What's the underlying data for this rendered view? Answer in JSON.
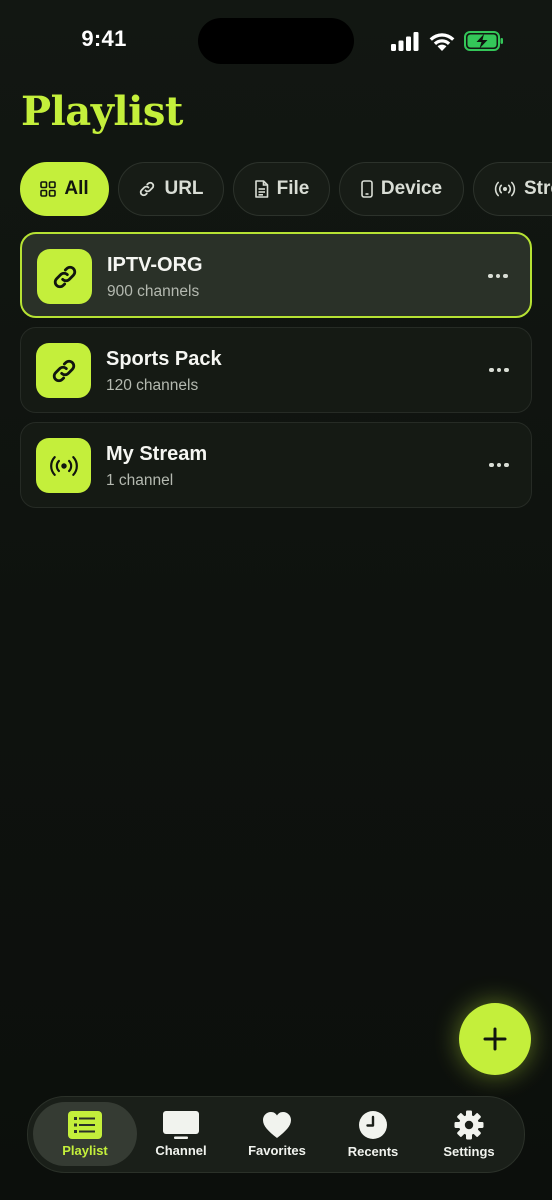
{
  "status_bar": {
    "time": "9:41"
  },
  "page": {
    "title": "Playlist"
  },
  "filters": [
    {
      "label": "All",
      "icon": "grid-icon",
      "active": true
    },
    {
      "label": "URL",
      "icon": "link-icon",
      "active": false
    },
    {
      "label": "File",
      "icon": "file-icon",
      "active": false
    },
    {
      "label": "Device",
      "icon": "phone-icon",
      "active": false
    },
    {
      "label": "Stre",
      "icon": "broadcast-icon",
      "active": false
    }
  ],
  "playlists": [
    {
      "title": "IPTV-ORG",
      "subtitle": "900 channels",
      "icon": "link-icon",
      "selected": true
    },
    {
      "title": "Sports Pack",
      "subtitle": "120 channels",
      "icon": "link-icon",
      "selected": false
    },
    {
      "title": "My Stream",
      "subtitle": "1 channel",
      "icon": "broadcast-icon",
      "selected": false
    }
  ],
  "tabs": [
    {
      "label": "Playlist",
      "icon": "playlist-icon",
      "active": true
    },
    {
      "label": "Channel",
      "icon": "tv-icon",
      "active": false
    },
    {
      "label": "Favorites",
      "icon": "heart-icon",
      "active": false
    },
    {
      "label": "Recents",
      "icon": "clock-icon",
      "active": false
    },
    {
      "label": "Settings",
      "icon": "gear-icon",
      "active": false
    }
  ],
  "colors": {
    "accent": "#c4ef3b",
    "background": "#0f130f",
    "card": "#151a14",
    "card_selected": "#2a3128",
    "battery": "#34c759"
  }
}
